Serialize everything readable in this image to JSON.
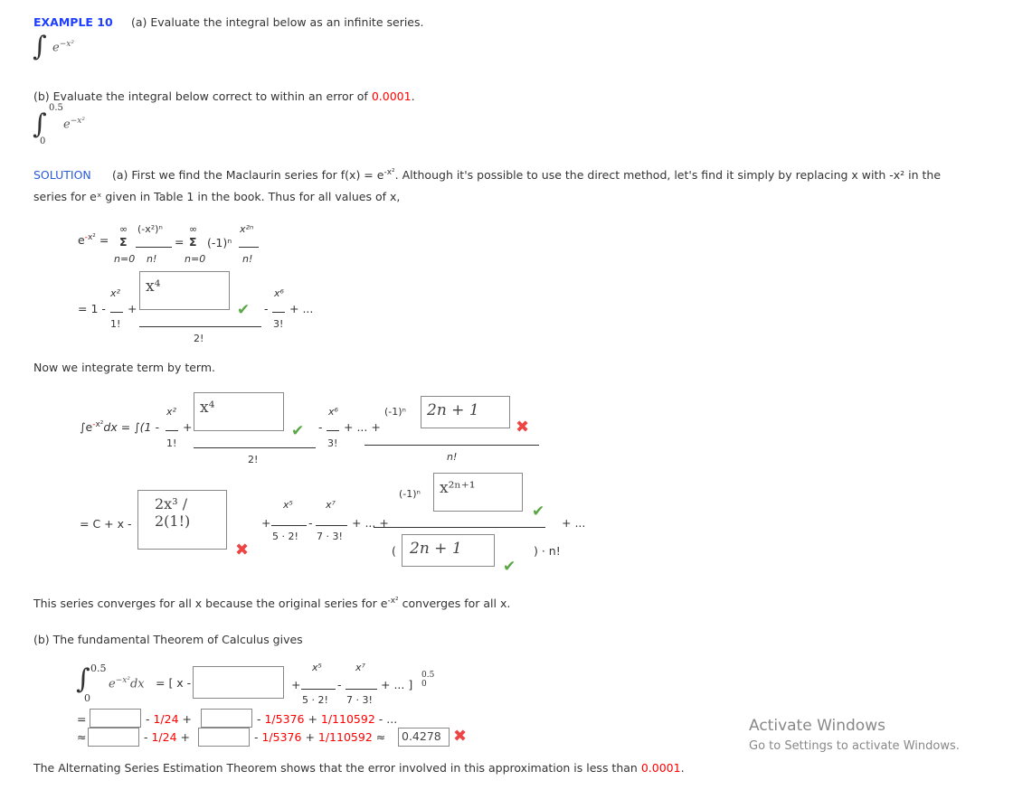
{
  "header": {
    "label": "EXAMPLE 10",
    "part_a": "(a) Evaluate the integral below as an infinite series.",
    "part_b_prefix": "(b) Evaluate the integral below correct to within an error of ",
    "part_b_error": "0.0001",
    "part_b_suffix": ".",
    "upper_limit": "0.5",
    "lower_limit": "0"
  },
  "solution": {
    "label": "SOLUTION",
    "line1": "(a) First we find the Maclaurin series for f(x) = e",
    "line1b": ". Although it's possible to use the direct method, let's find it simply by replacing x with -x² in the",
    "line2": "series for eˣ given in Table 1 in the book. Thus for all values of x,"
  },
  "series": {
    "sum1_num": "(-x²)ⁿ",
    "den_n": "n!",
    "inf": "∞",
    "sigma": "Σ",
    "n0": "n=0",
    "neg1n": "(-1)ⁿ",
    "x2n": "x²ⁿ",
    "one": "= 1 -",
    "x2": "x²",
    "f1": "1!",
    "f2": "2!",
    "f3": "3!",
    "x6": "x⁶",
    "tail": "+ ...",
    "input_x4": "x⁴"
  },
  "integrate": {
    "text": "Now we integrate term by term.",
    "lhs": "∫e",
    "dx": "dx = ∫(1 -",
    "input_x4": "x⁴",
    "dots": "+ ... +",
    "input_general": "2n + 1",
    "nfact": "n!"
  },
  "antideriv": {
    "lhs": "= C + x -",
    "input_term": "2x³ / 2(1!)",
    "x5": "x⁵",
    "x7": "x⁷",
    "d5": "5 · 2!",
    "d7": "7 · 3!",
    "input_num": "x²ⁿ⁺¹",
    "input_den": "2n + 1",
    "close": ") · n!",
    "open": "("
  },
  "converge": {
    "text": "This series converges for all x because the original series for e",
    "text2": "converges for all x."
  },
  "part_b": {
    "text": "(b) The fundamental Theorem of Calculus gives",
    "eq": "= [ x -",
    "bracket_end": "]",
    "r1_eq": "=",
    "r2_approx": "≈",
    "t24": "1/24",
    "t5376": "1/5376",
    "t110592": "1/110592",
    "ellipsis": "- ...",
    "answer": "0.4278"
  },
  "footer": {
    "text": "The Alternating Series Estimation Theorem shows that the error involved in this approximation is less than ",
    "error": "0.0001",
    "end": "."
  },
  "watermark": {
    "title": "Activate Windows",
    "sub": "Go to Settings to activate Windows."
  },
  "colors": {
    "accent": "#1f3fff",
    "error": "#ff0000",
    "correct": "#5aa845"
  }
}
